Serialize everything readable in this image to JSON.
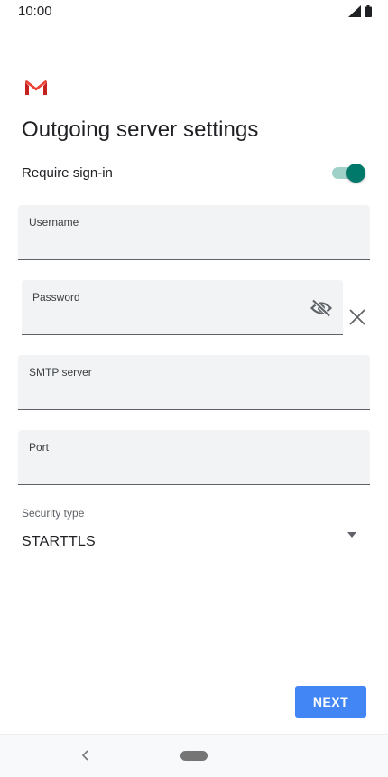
{
  "status_bar": {
    "time": "10:00",
    "icons": [
      "signal-icon",
      "battery-icon"
    ]
  },
  "app": {
    "logo": "gmail-logo",
    "title": "Outgoing server settings"
  },
  "require_signin": {
    "label": "Require sign-in",
    "enabled": true
  },
  "fields": {
    "username": {
      "label": "Username",
      "value": ""
    },
    "password": {
      "label": "Password",
      "value": "",
      "visibility_icon": "eye-off-icon",
      "clear_icon": "close-icon"
    },
    "smtp_server": {
      "label": "SMTP server",
      "value": ""
    },
    "port": {
      "label": "Port",
      "value": ""
    }
  },
  "security": {
    "label": "Security type",
    "value": "STARTTLS",
    "icon": "arrow-drop-down-icon"
  },
  "actions": {
    "next_label": "NEXT"
  },
  "colors": {
    "accent": "#00796b",
    "button": "#4285f4",
    "field_bg": "#f1f3f4"
  }
}
